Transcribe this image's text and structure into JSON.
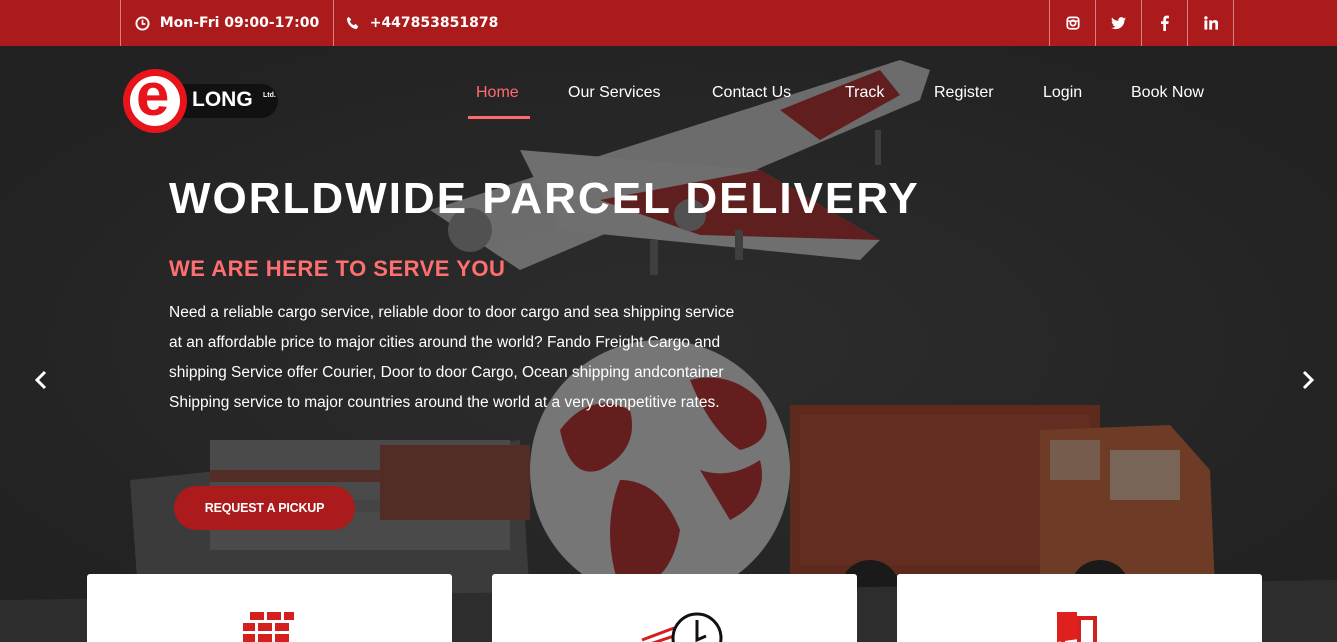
{
  "topbar": {
    "hours": "Mon-Fri 09:00-17:00",
    "phone": "+447853851878",
    "social": [
      "instagram-icon",
      "twitter-icon",
      "facebook-icon",
      "linkedin-icon"
    ]
  },
  "logo": {
    "letter": "e",
    "word": "LONG",
    "suffix": "Ltd."
  },
  "nav": {
    "items": [
      {
        "label": "Home",
        "active": true
      },
      {
        "label": "Our Services",
        "active": false
      },
      {
        "label": "Contact Us",
        "active": false
      },
      {
        "label": "Track",
        "active": false
      },
      {
        "label": "Register",
        "active": false
      },
      {
        "label": "Login",
        "active": false
      },
      {
        "label": "Book Now",
        "active": false
      }
    ]
  },
  "hero": {
    "title": "WORLDWIDE PARCEL DELIVERY",
    "subtitle": "WE ARE HERE TO SERVE YOU",
    "body": "Need a reliable cargo service, reliable door to door cargo and sea shipping service at an affordable price to major cities around the world? Fando Freight Cargo and shipping Service offer Courier, Door to door Cargo, Ocean shipping andcontainer Shipping service to major countries around the world at a very competitive rates.",
    "cta": "REQUEST A PICKUP"
  },
  "colors": {
    "brand": "#ac1b1b",
    "accent": "#ff6b6b"
  },
  "cards": [
    {
      "icon": "brick-stack-icon"
    },
    {
      "icon": "fast-clock-icon"
    },
    {
      "icon": "open-door-icon"
    }
  ]
}
